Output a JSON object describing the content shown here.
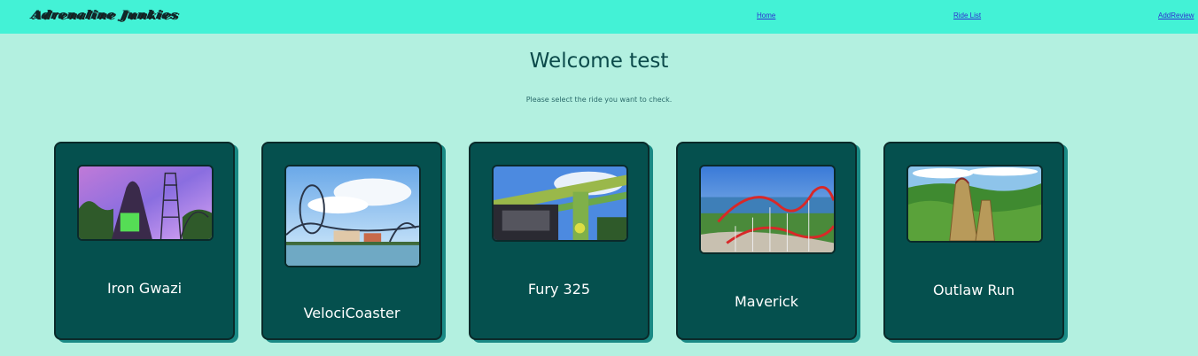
{
  "nav": {
    "logo": "Adrenaline Junkies",
    "links": [
      "Home",
      "Ride List",
      "AddReview"
    ]
  },
  "main": {
    "heading": "Welcome test",
    "subtext": "Please select the ride you want to check."
  },
  "rides": [
    {
      "name": "Iron Gwazi",
      "image_icon": "roller-coaster-photo"
    },
    {
      "name": "VelociCoaster",
      "image_icon": "roller-coaster-photo"
    },
    {
      "name": "Fury 325",
      "image_icon": "roller-coaster-photo"
    },
    {
      "name": "Maverick",
      "image_icon": "roller-coaster-photo"
    },
    {
      "name": "Outlaw Run",
      "image_icon": "roller-coaster-photo"
    }
  ],
  "colors": {
    "navbar": "#43f2d6",
    "background": "#b3f0e0",
    "card": "#05504e",
    "card_shadow": "#1a8a85"
  }
}
